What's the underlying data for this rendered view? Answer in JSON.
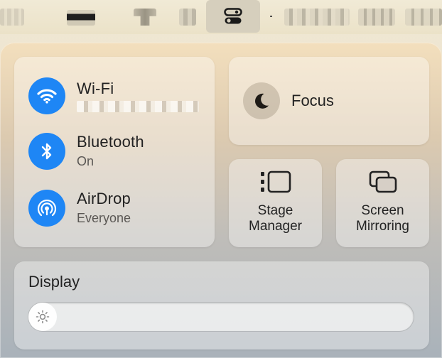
{
  "menubar": {
    "control_center_icon": "control-center-toggle-icon"
  },
  "network": {
    "wifi": {
      "title": "Wi-Fi",
      "icon": "wifi-icon",
      "accent": "#1e86f5"
    },
    "bluetooth": {
      "title": "Bluetooth",
      "subtitle": "On",
      "icon": "bluetooth-icon"
    },
    "airdrop": {
      "title": "AirDrop",
      "subtitle": "Everyone",
      "icon": "airdrop-icon"
    }
  },
  "focus": {
    "label": "Focus",
    "icon": "moon-icon"
  },
  "stage_manager": {
    "line1": "Stage",
    "line2": "Manager",
    "icon": "stage-manager-icon"
  },
  "screen_mirroring": {
    "line1": "Screen",
    "line2": "Mirroring",
    "icon": "screen-mirroring-icon"
  },
  "display": {
    "title": "Display",
    "brightness": 0.06,
    "icon": "sun-icon"
  }
}
